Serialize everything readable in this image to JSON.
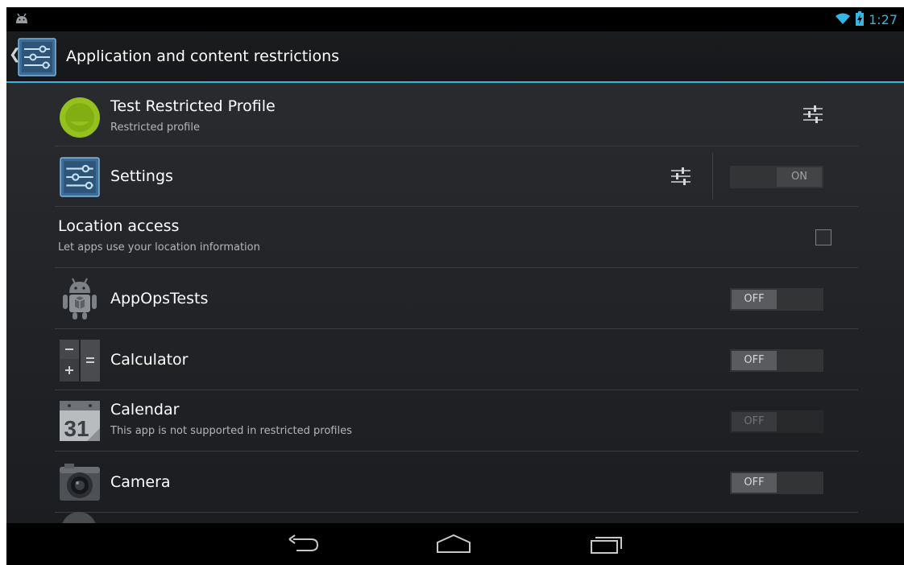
{
  "status_bar": {
    "time": "1:27",
    "icons": [
      "android-notification-icon",
      "wifi-icon",
      "battery-charging-icon"
    ],
    "accent_color": "#33b5e5"
  },
  "action_bar": {
    "title": "Application and content restrictions",
    "app_icon": "settings-sliders-icon"
  },
  "profile": {
    "name": "Test Restricted Profile",
    "summary": "Restricted profile",
    "settings_icon": "restriction-settings-icon"
  },
  "settings_app": {
    "label": "Settings",
    "switch_label": "ON",
    "switch_state": "on"
  },
  "location": {
    "title": "Location access",
    "summary": "Let apps use your location information",
    "checked": false
  },
  "apps": [
    {
      "label": "AppOpsTests",
      "icon": "android-robot-icon",
      "switch_label": "OFF",
      "enabled": true
    },
    {
      "label": "Calculator",
      "icon": "calculator-icon",
      "switch_label": "OFF",
      "enabled": true
    },
    {
      "label": "Calendar",
      "summary": "This app is not supported in restricted profiles",
      "icon": "calendar-icon",
      "icon_text": "31",
      "switch_label": "OFF",
      "enabled": false
    },
    {
      "label": "Camera",
      "icon": "camera-icon",
      "switch_label": "OFF",
      "enabled": true
    }
  ],
  "nav_bar": {
    "buttons": [
      "back-icon",
      "home-icon",
      "recent-apps-icon"
    ]
  }
}
